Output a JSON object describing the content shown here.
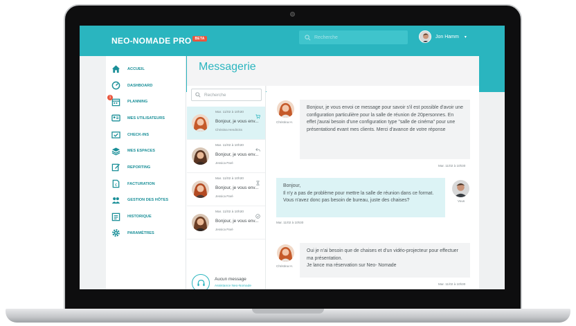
{
  "app": {
    "logo": "NEO-NOMADE PRO",
    "logo_badge": "BETA",
    "search_placeholder": "Recherche",
    "user_name": "Jon Hamm",
    "user_caret": "▾"
  },
  "sidebar": {
    "items": [
      {
        "label": "ACCUEIL",
        "icon": "home-icon"
      },
      {
        "label": "DASHBOARD",
        "icon": "speedometer-icon"
      },
      {
        "label": "PLANNING",
        "icon": "calendar-icon",
        "badge": "1"
      },
      {
        "label": "MES UTILISATEURS",
        "icon": "users-card-icon"
      },
      {
        "label": "CHECK-INS",
        "icon": "checkin-icon"
      },
      {
        "label": "MES ESPACES",
        "icon": "layers-icon"
      },
      {
        "label": "REPORTING",
        "icon": "edit-icon"
      },
      {
        "label": "FACTURATION",
        "icon": "invoice-icon"
      },
      {
        "label": "GESTION DES HÔTES",
        "icon": "hosts-icon"
      },
      {
        "label": "HISTORIQUE",
        "icon": "history-icon"
      },
      {
        "label": "PARAMÈTRES",
        "icon": "gear-icon"
      }
    ]
  },
  "main": {
    "title": "Messagerie",
    "list_search_placeholder": "Recherche"
  },
  "threads": [
    {
      "date": "Mar. 11/02 à 10h30",
      "snippet": "Bonjour, je vous env...",
      "author": "Christina Hendricks",
      "status_icon": "cart-icon",
      "active": true
    },
    {
      "date": "Mar. 11/02 à 10h30",
      "snippet": "Bonjour, je vous env...",
      "author": "Jessica Paré",
      "status_icon": "reply-icon",
      "active": false
    },
    {
      "date": "Mar. 11/02 à 10h30",
      "snippet": "Bonjour, je vous env...",
      "author": "Jessica Paré",
      "status_icon": "hourglass-icon",
      "active": false
    },
    {
      "date": "Mar. 11/02 à 10h30",
      "snippet": "Bonjour, je vous env...",
      "author": "Jessica Paré",
      "status_icon": "check-circle-icon",
      "active": false
    }
  ],
  "support": {
    "none_label": "Aucun message",
    "team_label": "Assistance Neo-Nomade"
  },
  "messages": [
    {
      "who": "Christina H.",
      "direction": "in",
      "text": "Bonjour, je vous envoi ce message pour savoir s'il est possible d'avoir une configuration particulière pour la salle de réunion de 20personnes. En effet j'aurai besoin d'une configuration type \"salle de cinéma\" pour une présentationd evant mes clients. Merci d'avance de votre réponse",
      "time": "Mar. 11/02 à 10h30"
    },
    {
      "who": "Vous",
      "direction": "out",
      "text": "Bonjour,\nIl n'y a pas de problème pour mettre la salle de réunion dans ce format. Vous n'avez donc pas besoin de bureau, juste des chaises?",
      "time": "Mar. 11/02 à 10h30"
    },
    {
      "who": "Christina H.",
      "direction": "in",
      "text": "Oui je n'ai besoin que de chaises et d'un vidéo-projecteur pour effectuer ma présentation.\nJe lance ma réservation sur Neo- Nomade",
      "time": "Mar. 11/02 à 10h30"
    }
  ]
}
